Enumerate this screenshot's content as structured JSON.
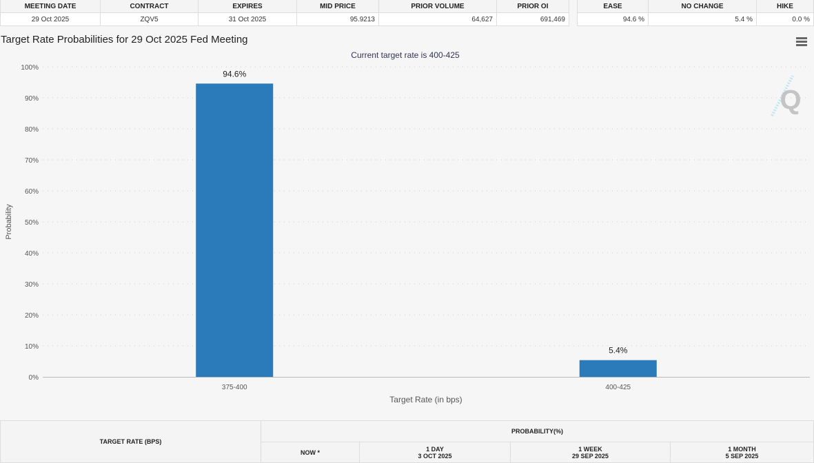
{
  "summary": {
    "headers": [
      "MEETING DATE",
      "CONTRACT",
      "EXPIRES",
      "MID PRICE",
      "PRIOR VOLUME",
      "PRIOR OI"
    ],
    "values": [
      "29 Oct 2025",
      "ZQV5",
      "31 Oct 2025",
      "95.9213",
      "64,627",
      "691,469"
    ],
    "prob_headers": [
      "EASE",
      "NO CHANGE",
      "HIKE"
    ],
    "prob_values": [
      "94.6 %",
      "5.4 %",
      "0.0 %"
    ]
  },
  "chart_title": "Target Rate Probabilities for 29 Oct 2025 Fed Meeting",
  "chart_data": {
    "type": "bar",
    "title": "Target Rate Probabilities for 29 Oct 2025 Fed Meeting",
    "subtitle": "Current target rate is 400-425",
    "categories": [
      "375-400",
      "400-425"
    ],
    "values": [
      94.6,
      5.4
    ],
    "data_labels": [
      "94.6%",
      "5.4%"
    ],
    "xlabel": "Target Rate (in bps)",
    "ylabel": "Probability",
    "ylim": [
      0,
      100
    ],
    "yticks": [
      "0%",
      "10%",
      "20%",
      "30%",
      "40%",
      "50%",
      "60%",
      "70%",
      "80%",
      "90%",
      "100%"
    ],
    "grid": true,
    "color": "#2b7bba"
  },
  "bottom_table": {
    "target_rate_header": "TARGET RATE (BPS)",
    "probability_header": "PROBABILITY(%)",
    "columns": [
      {
        "l1": "NOW *",
        "l2": ""
      },
      {
        "l1": "1 DAY",
        "l2": "3 OCT 2025"
      },
      {
        "l1": "1 WEEK",
        "l2": "29 SEP 2025"
      },
      {
        "l1": "1 MONTH",
        "l2": "5 SEP 2025"
      }
    ]
  }
}
